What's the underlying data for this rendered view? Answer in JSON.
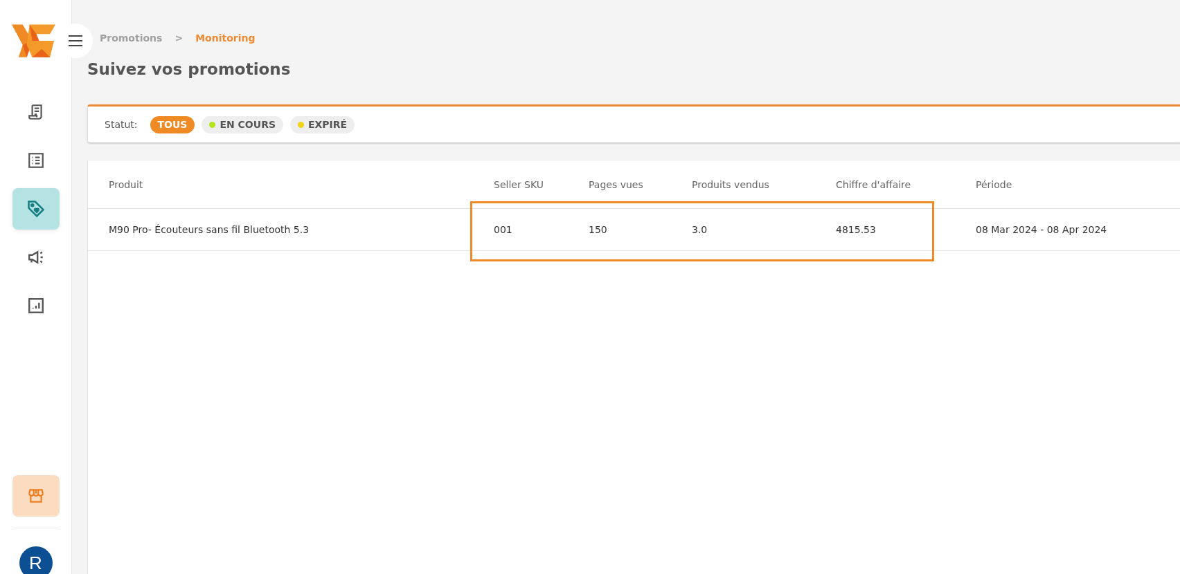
{
  "breadcrumb": [
    {
      "label": "Promotions",
      "selected": false
    },
    {
      "label": "Monitoring",
      "selected": true
    }
  ],
  "breadcrumb_separator": ">",
  "sidebar": {
    "items": [
      {
        "kind": "receipt",
        "selected": false
      },
      {
        "kind": "list",
        "selected": false
      },
      {
        "kind": "tag",
        "selected": true
      },
      {
        "kind": "megaphone",
        "selected": false
      },
      {
        "kind": "chart",
        "selected": false
      }
    ],
    "store_button": {
      "kind": "store"
    },
    "avatar": "R"
  },
  "title": "Suivez vos promotions",
  "filter": {
    "label": "Statut:",
    "chips": [
      {
        "label": "TOUS",
        "selected": true
      },
      {
        "label": "EN COURS",
        "selected": false,
        "color": "#b5e61d"
      },
      {
        "label": "EXPIRÉ",
        "selected": false,
        "color": "#f2d31b"
      }
    ]
  },
  "table": {
    "columns": [
      "Produit",
      "Seller SKU",
      "Pages vues",
      "Produits vendus",
      "Chiffre d'affaire",
      "Période"
    ],
    "rows": [
      [
        "M90 Pro- Écouteurs sans fil Bluetooth 5.3",
        "001",
        "150",
        "3.0",
        "4815.53",
        "08 Mar 2024 - 08 Apr 2024"
      ]
    ]
  },
  "annotation": {
    "kind": "rectangle"
  }
}
